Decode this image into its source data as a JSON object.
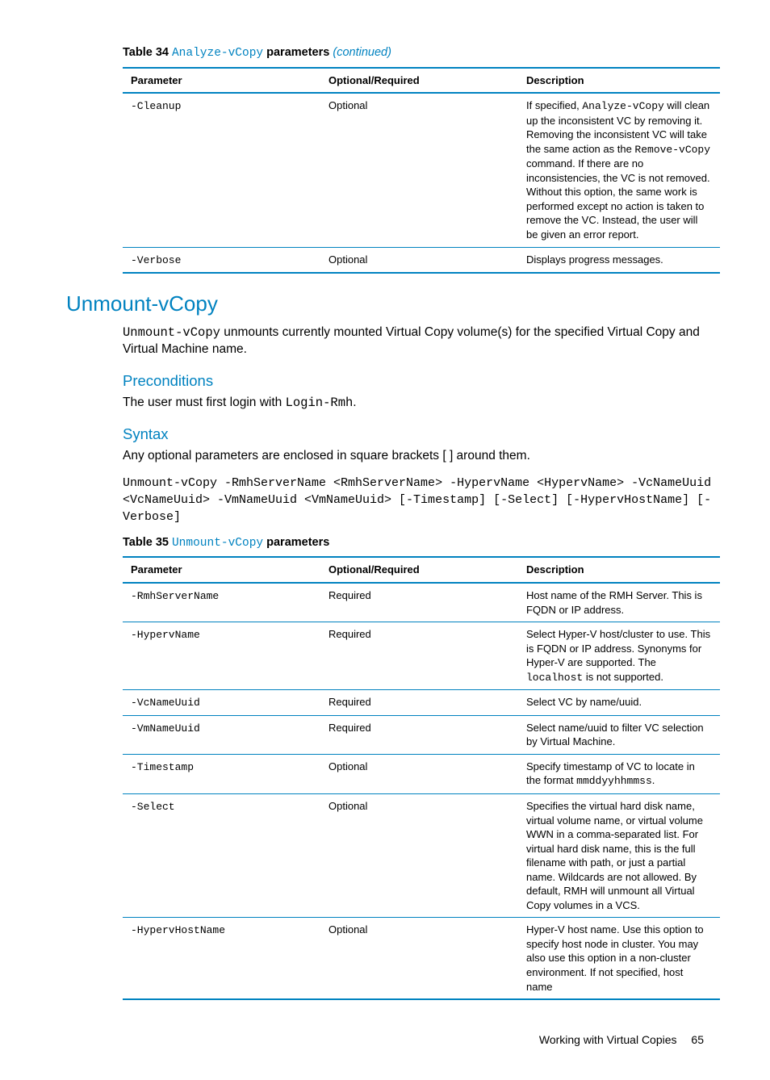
{
  "table34": {
    "caption_lead": "Table 34 ",
    "caption_code": "Analyze-vCopy",
    "caption_tail": " parameters ",
    "caption_cont": "(continued)",
    "headers": [
      "Parameter",
      "Optional/Required",
      "Description"
    ],
    "rows": [
      {
        "param": "-Cleanup",
        "opt": "Optional",
        "desc_parts": [
          {
            "t": "If specified, "
          },
          {
            "t": "Analyze-vCopy",
            "mono": true
          },
          {
            "t": " will clean up the inconsistent VC by removing it. Removing the inconsistent VC will take the same action as the "
          },
          {
            "t": "Remove-vCopy",
            "mono": true
          },
          {
            "t": " command. If there are no inconsistencies, the VC is not removed. Without this option, the same work is performed except no action is taken to remove the VC. Instead, the user will be given an error report."
          }
        ]
      },
      {
        "param": "-Verbose",
        "opt": "Optional",
        "desc_parts": [
          {
            "t": "Displays progress messages."
          }
        ]
      }
    ]
  },
  "section": {
    "title": "Unmount-vCopy",
    "intro_parts": [
      {
        "t": "Unmount-vCopy",
        "mono": true
      },
      {
        "t": " unmounts currently mounted Virtual Copy volume(s) for the specified Virtual Copy and Virtual Machine name."
      }
    ],
    "preconditions_title": "Preconditions",
    "preconditions_parts": [
      {
        "t": "The user must first login with "
      },
      {
        "t": "Login-Rmh",
        "mono": true
      },
      {
        "t": "."
      }
    ],
    "syntax_title": "Syntax",
    "syntax_note": "Any optional parameters are enclosed in square brackets [ ] around them.",
    "syntax_code": "Unmount-vCopy -RmhServerName <RmhServerName> -HypervName <HypervName> -VcNameUuid <VcNameUuid> -VmNameUuid <VmNameUuid> [-Timestamp] [-Select] [-HypervHostName] [-Verbose]"
  },
  "table35": {
    "caption_lead": "Table 35 ",
    "caption_code": "Unmount-vCopy",
    "caption_tail": " parameters",
    "headers": [
      "Parameter",
      "Optional/Required",
      "Description"
    ],
    "rows": [
      {
        "param": "-RmhServerName",
        "opt": "Required",
        "desc_parts": [
          {
            "t": "Host name of the RMH Server. This is FQDN or IP address."
          }
        ]
      },
      {
        "param": "-HypervName",
        "opt": "Required",
        "desc_parts": [
          {
            "t": "Select Hyper-V host/cluster to use. This is FQDN or IP address. Synonyms for Hyper-V are supported. The "
          },
          {
            "t": "localhost",
            "mono": true
          },
          {
            "t": " is not supported."
          }
        ]
      },
      {
        "param": "-VcNameUuid",
        "opt": "Required",
        "desc_parts": [
          {
            "t": "Select VC by name/uuid."
          }
        ]
      },
      {
        "param": "-VmNameUuid",
        "opt": "Required",
        "desc_parts": [
          {
            "t": "Select name/uuid to filter VC selection by Virtual Machine."
          }
        ]
      },
      {
        "param": "-Timestamp",
        "opt": "Optional",
        "desc_parts": [
          {
            "t": "Specify timestamp of VC to locate in the format "
          },
          {
            "t": "mmddyyhhmmss",
            "mono": true
          },
          {
            "t": "."
          }
        ]
      },
      {
        "param": "-Select",
        "opt": "Optional",
        "desc_parts": [
          {
            "t": "Specifies the virtual hard disk name, virtual volume name, or virtual volume WWN in a comma-separated list. For virtual hard disk name, this is the full filename with path, or just a partial name. Wildcards are not allowed. By default, RMH will unmount all Virtual Copy volumes in a VCS."
          }
        ]
      },
      {
        "param": "-HypervHostName",
        "opt": "Optional",
        "desc_parts": [
          {
            "t": "Hyper-V host name. Use this option to specify host node in cluster. You may also use this option in a non-cluster environment. If not specified, host name"
          }
        ]
      }
    ]
  },
  "footer": {
    "text": "Working with Virtual Copies",
    "page": "65"
  }
}
